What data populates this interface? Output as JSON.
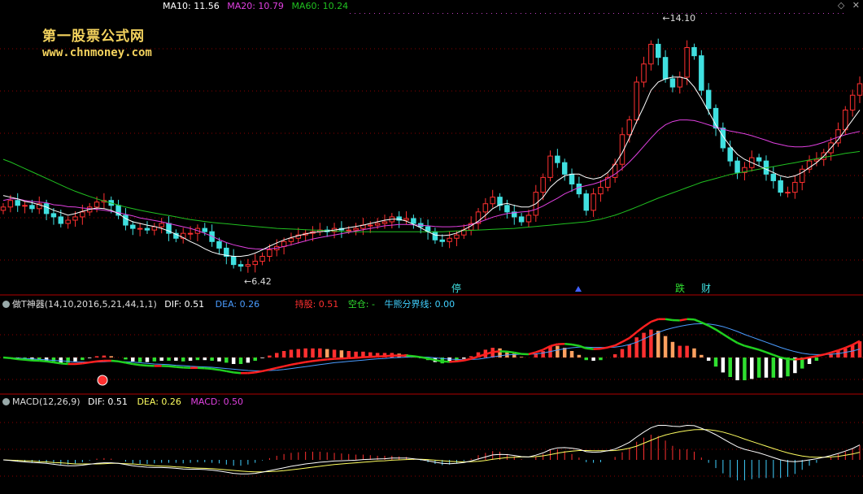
{
  "watermark": {
    "title": "第一股票公式网",
    "url": "www.chnmoney.com"
  },
  "top_legend": [
    {
      "label": "MA10: 11.56",
      "color": "#ffffff"
    },
    {
      "label": "MA20: 10.79",
      "color": "#e040e0"
    },
    {
      "label": "MA60: 10.24",
      "color": "#20c020"
    }
  ],
  "top_icons": {
    "diamond": "◇",
    "close": "✕"
  },
  "price_annotations": {
    "high_label": "14.10",
    "low_label": "6.42"
  },
  "signal_markers": [
    "停",
    "跌",
    "财"
  ],
  "panel2": {
    "title": "做T神器(14,10,2016,5,21,44,1,1)",
    "items": [
      {
        "label": "DIF: 0.51",
        "color": "#ffffff"
      },
      {
        "label": "DEA: 0.26",
        "color": "#4a9cff"
      },
      {
        "label": "持股: 0.51",
        "color": "#ff3030"
      },
      {
        "label": "空仓: -",
        "color": "#30e030"
      },
      {
        "label": "牛熊分界线: 0.00",
        "color": "#40d0ff"
      }
    ]
  },
  "panel3": {
    "title": "MACD(12,26,9)",
    "items": [
      {
        "label": "DIF: 0.51",
        "color": "#ffffff"
      },
      {
        "label": "DEA: 0.26",
        "color": "#ffff60"
      },
      {
        "label": "MACD: 0.50",
        "color": "#e040e0"
      }
    ]
  },
  "colors": {
    "up": "#ff3030",
    "down": "#40e0e0",
    "ma10": "#ffffff",
    "ma20": "#e040e0",
    "ma60": "#20c020",
    "grid": "#8b0000"
  },
  "chart_data": {
    "type": "candlestick",
    "price_range": [
      6.0,
      14.5
    ],
    "close": [
      8.55,
      8.75,
      8.6,
      8.6,
      8.5,
      8.65,
      8.35,
      8.25,
      8.05,
      8.15,
      8.25,
      8.4,
      8.55,
      8.7,
      8.75,
      8.6,
      8.3,
      8.0,
      7.9,
      7.9,
      7.85,
      7.95,
      8.05,
      7.75,
      7.6,
      7.75,
      7.75,
      7.9,
      7.8,
      7.5,
      7.3,
      7.05,
      6.8,
      6.75,
      6.8,
      6.9,
      7.05,
      7.25,
      7.35,
      7.5,
      7.6,
      7.7,
      7.75,
      7.8,
      7.85,
      7.8,
      7.9,
      7.85,
      7.85,
      7.9,
      8.0,
      8.0,
      8.05,
      8.1,
      8.25,
      8.15,
      8.2,
      8.05,
      7.95,
      7.8,
      7.55,
      7.5,
      7.6,
      7.7,
      7.85,
      8.05,
      8.4,
      8.65,
      8.85,
      8.6,
      8.4,
      8.25,
      8.1,
      8.3,
      9.0,
      9.45,
      10.1,
      9.9,
      9.55,
      9.25,
      8.95,
      8.45,
      8.95,
      9.15,
      9.45,
      9.85,
      10.75,
      11.2,
      12.35,
      12.9,
      13.5,
      13.1,
      12.45,
      12.2,
      12.5,
      13.4,
      13.15,
      12.1,
      11.55,
      10.95,
      10.35,
      9.95,
      9.6,
      9.75,
      10.05,
      9.95,
      9.55,
      9.35,
      9.0,
      9.0,
      9.3,
      9.7,
      9.95,
      10.0,
      10.2,
      10.5,
      10.9,
      11.5,
      11.95,
      12.3
    ],
    "ma10": [
      8.9,
      8.85,
      8.8,
      8.72,
      8.68,
      8.62,
      8.55,
      8.45,
      8.38,
      8.3,
      8.35,
      8.42,
      8.48,
      8.52,
      8.5,
      8.45,
      8.35,
      8.2,
      8.1,
      8.05,
      8.0,
      7.96,
      7.9,
      7.82,
      7.72,
      7.62,
      7.5,
      7.4,
      7.28,
      7.18,
      7.12,
      7.08,
      7.05,
      7.05,
      7.08,
      7.15,
      7.25,
      7.36,
      7.46,
      7.55,
      7.62,
      7.68,
      7.73,
      7.78,
      7.8,
      7.82,
      7.85,
      7.88,
      7.92,
      7.96,
      8.0,
      8.05,
      8.1,
      8.15,
      8.18,
      8.18,
      8.12,
      8.02,
      7.92,
      7.8,
      7.7,
      7.68,
      7.7,
      7.76,
      7.86,
      7.98,
      8.12,
      8.3,
      8.5,
      8.62,
      8.66,
      8.6,
      8.55,
      8.55,
      8.65,
      8.85,
      9.15,
      9.35,
      9.5,
      9.55,
      9.55,
      9.45,
      9.4,
      9.45,
      9.6,
      9.85,
      10.2,
      10.65,
      11.15,
      11.6,
      12.1,
      12.35,
      12.45,
      12.5,
      12.5,
      12.45,
      12.2,
      11.85,
      11.45,
      11.05,
      10.7,
      10.4,
      10.15,
      10.0,
      9.9,
      9.8,
      9.7,
      9.6,
      9.5,
      9.45,
      9.5,
      9.6,
      9.75,
      9.9,
      10.1,
      10.35,
      10.6,
      10.9,
      11.2,
      11.5
    ],
    "ma20": [
      8.75,
      8.8,
      8.8,
      8.75,
      8.72,
      8.7,
      8.68,
      8.62,
      8.6,
      8.56,
      8.55,
      8.52,
      8.5,
      8.48,
      8.45,
      8.42,
      8.38,
      8.33,
      8.28,
      8.22,
      8.18,
      8.14,
      8.1,
      8.05,
      8.0,
      7.95,
      7.9,
      7.83,
      7.75,
      7.66,
      7.56,
      7.47,
      7.4,
      7.35,
      7.3,
      7.28,
      7.27,
      7.28,
      7.3,
      7.35,
      7.4,
      7.46,
      7.52,
      7.58,
      7.62,
      7.66,
      7.7,
      7.74,
      7.78,
      7.82,
      7.86,
      7.9,
      7.94,
      7.98,
      8.0,
      8.02,
      8.02,
      8.01,
      8.0,
      7.98,
      7.96,
      7.95,
      7.95,
      7.96,
      7.98,
      8.02,
      8.08,
      8.16,
      8.24,
      8.3,
      8.35,
      8.38,
      8.4,
      8.42,
      8.48,
      8.58,
      8.7,
      8.82,
      8.95,
      9.05,
      9.15,
      9.2,
      9.25,
      9.32,
      9.42,
      9.55,
      9.72,
      9.92,
      10.15,
      10.4,
      10.65,
      10.88,
      11.05,
      11.15,
      11.2,
      11.2,
      11.18,
      11.12,
      11.05,
      10.98,
      10.92,
      10.86,
      10.82,
      10.78,
      10.72,
      10.65,
      10.58,
      10.5,
      10.45,
      10.4,
      10.38,
      10.38,
      10.4,
      10.45,
      10.52,
      10.6,
      10.68,
      10.75,
      10.8,
      10.85
    ],
    "ma60": [
      10.0,
      9.92,
      9.82,
      9.72,
      9.62,
      9.52,
      9.42,
      9.32,
      9.22,
      9.12,
      9.03,
      8.95,
      8.87,
      8.8,
      8.73,
      8.67,
      8.61,
      8.55,
      8.5,
      8.45,
      8.41,
      8.37,
      8.33,
      8.29,
      8.25,
      8.21,
      8.17,
      8.14,
      8.11,
      8.08,
      8.06,
      8.04,
      8.02,
      8.0,
      7.98,
      7.96,
      7.94,
      7.92,
      7.9,
      7.89,
      7.88,
      7.87,
      7.86,
      7.85,
      7.84,
      7.83,
      7.82,
      7.81,
      7.8,
      7.8,
      7.8,
      7.8,
      7.8,
      7.8,
      7.8,
      7.8,
      7.8,
      7.8,
      7.8,
      7.8,
      7.8,
      7.8,
      7.81,
      7.82,
      7.83,
      7.84,
      7.85,
      7.86,
      7.87,
      7.88,
      7.89,
      7.9,
      7.92,
      7.94,
      7.96,
      7.98,
      8.0,
      8.02,
      8.04,
      8.06,
      8.08,
      8.1,
      8.14,
      8.18,
      8.24,
      8.3,
      8.38,
      8.46,
      8.55,
      8.64,
      8.73,
      8.82,
      8.9,
      8.98,
      9.06,
      9.14,
      9.22,
      9.3,
      9.36,
      9.42,
      9.48,
      9.54,
      9.58,
      9.62,
      9.66,
      9.7,
      9.74,
      9.78,
      9.82,
      9.86,
      9.9,
      9.94,
      9.98,
      10.02,
      10.06,
      10.1,
      10.14,
      10.18,
      10.21,
      10.24
    ],
    "dif": [
      0.0,
      -0.02,
      -0.05,
      -0.07,
      -0.09,
      -0.1,
      -0.12,
      -0.15,
      -0.18,
      -0.2,
      -0.2,
      -0.18,
      -0.15,
      -0.12,
      -0.1,
      -0.1,
      -0.12,
      -0.16,
      -0.2,
      -0.23,
      -0.25,
      -0.26,
      -0.26,
      -0.27,
      -0.29,
      -0.31,
      -0.32,
      -0.32,
      -0.33,
      -0.35,
      -0.38,
      -0.42,
      -0.46,
      -0.48,
      -0.48,
      -0.46,
      -0.42,
      -0.37,
      -0.32,
      -0.27,
      -0.22,
      -0.18,
      -0.14,
      -0.11,
      -0.08,
      -0.06,
      -0.04,
      -0.03,
      -0.02,
      -0.01,
      0.01,
      0.02,
      0.03,
      0.04,
      0.06,
      0.06,
      0.06,
      0.04,
      0.01,
      -0.03,
      -0.08,
      -0.12,
      -0.13,
      -0.12,
      -0.09,
      -0.04,
      0.03,
      0.1,
      0.17,
      0.19,
      0.18,
      0.15,
      0.11,
      0.1,
      0.16,
      0.24,
      0.35,
      0.41,
      0.42,
      0.4,
      0.36,
      0.28,
      0.26,
      0.27,
      0.31,
      0.37,
      0.48,
      0.6,
      0.78,
      0.95,
      1.1,
      1.18,
      1.18,
      1.15,
      1.14,
      1.18,
      1.17,
      1.08,
      0.98,
      0.86,
      0.72,
      0.58,
      0.45,
      0.36,
      0.3,
      0.24,
      0.16,
      0.08,
      0.0,
      -0.05,
      -0.06,
      -0.04,
      0.0,
      0.04,
      0.09,
      0.15,
      0.22,
      0.3,
      0.39,
      0.51
    ],
    "dea": [
      0.0,
      -0.01,
      -0.02,
      -0.03,
      -0.04,
      -0.06,
      -0.07,
      -0.09,
      -0.1,
      -0.12,
      -0.14,
      -0.14,
      -0.14,
      -0.14,
      -0.13,
      -0.12,
      -0.12,
      -0.13,
      -0.14,
      -0.16,
      -0.18,
      -0.2,
      -0.21,
      -0.22,
      -0.24,
      -0.25,
      -0.27,
      -0.28,
      -0.29,
      -0.3,
      -0.32,
      -0.34,
      -0.36,
      -0.38,
      -0.4,
      -0.41,
      -0.41,
      -0.4,
      -0.39,
      -0.37,
      -0.34,
      -0.31,
      -0.28,
      -0.25,
      -0.22,
      -0.19,
      -0.16,
      -0.14,
      -0.12,
      -0.1,
      -0.08,
      -0.06,
      -0.04,
      -0.03,
      -0.01,
      0.0,
      0.01,
      0.02,
      0.02,
      0.01,
      -0.01,
      -0.03,
      -0.05,
      -0.06,
      -0.07,
      -0.06,
      -0.05,
      -0.02,
      0.02,
      0.05,
      0.08,
      0.09,
      0.1,
      0.1,
      0.11,
      0.14,
      0.18,
      0.23,
      0.27,
      0.3,
      0.32,
      0.32,
      0.31,
      0.31,
      0.31,
      0.32,
      0.35,
      0.4,
      0.47,
      0.57,
      0.67,
      0.77,
      0.85,
      0.91,
      0.96,
      1.0,
      1.03,
      1.04,
      1.03,
      1.0,
      0.95,
      0.88,
      0.8,
      0.71,
      0.63,
      0.55,
      0.47,
      0.39,
      0.31,
      0.24,
      0.18,
      0.13,
      0.1,
      0.09,
      0.09,
      0.1,
      0.12,
      0.16,
      0.2,
      0.26
    ]
  }
}
